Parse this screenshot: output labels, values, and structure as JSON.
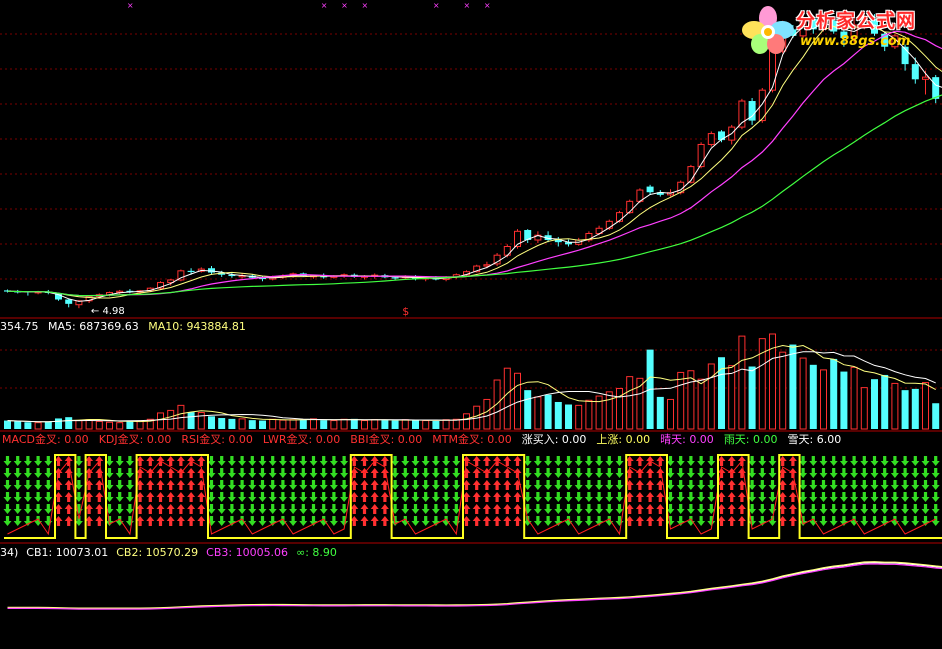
{
  "chart_data": [
    {
      "type": "candlestick",
      "annotations": {
        "low_label": "4.98",
        "top_markers": [
          "×",
          "×",
          "×",
          "×",
          "×",
          "×",
          "×"
        ],
        "signal_marker": "$"
      },
      "colors": {
        "up": "#ff3030",
        "down": "#54ffff",
        "ma_fast": "#ffffff",
        "ma_mid": "#ffff80",
        "ma_slow": "#ff40ff",
        "ma_long": "#40ff40"
      },
      "ohlc": [
        [
          5.39,
          5.41,
          5.34,
          5.37
        ],
        [
          5.37,
          5.4,
          5.32,
          5.36
        ],
        [
          5.37,
          5.36,
          5.27,
          5.35
        ],
        [
          5.35,
          5.38,
          5.3,
          5.36
        ],
        [
          5.36,
          5.4,
          5.3,
          5.33
        ],
        [
          5.33,
          5.34,
          5.15,
          5.18
        ],
        [
          5.18,
          5.2,
          5.0,
          5.08
        ],
        [
          5.06,
          5.17,
          4.98,
          5.15
        ],
        [
          5.15,
          5.27,
          5.1,
          5.25
        ],
        [
          5.25,
          5.32,
          5.2,
          5.29
        ],
        [
          5.29,
          5.36,
          5.25,
          5.34
        ],
        [
          5.34,
          5.4,
          5.3,
          5.37
        ],
        [
          5.38,
          5.42,
          5.32,
          5.35
        ],
        [
          5.35,
          5.4,
          5.3,
          5.38
        ],
        [
          5.38,
          5.46,
          5.35,
          5.44
        ],
        [
          5.44,
          5.6,
          5.4,
          5.57
        ],
        [
          5.57,
          5.65,
          5.5,
          5.63
        ],
        [
          5.63,
          5.87,
          5.6,
          5.84
        ],
        [
          5.84,
          5.9,
          5.75,
          5.83
        ],
        [
          5.83,
          5.92,
          5.8,
          5.88
        ],
        [
          5.9,
          5.95,
          5.75,
          5.8
        ],
        [
          5.8,
          5.84,
          5.7,
          5.75
        ],
        [
          5.75,
          5.8,
          5.68,
          5.72
        ],
        [
          5.72,
          5.78,
          5.66,
          5.73
        ],
        [
          5.73,
          5.76,
          5.65,
          5.68
        ],
        [
          5.7,
          5.72,
          5.6,
          5.65
        ],
        [
          5.65,
          5.73,
          5.62,
          5.7
        ],
        [
          5.7,
          5.76,
          5.65,
          5.72
        ],
        [
          5.72,
          5.8,
          5.68,
          5.77
        ],
        [
          5.78,
          5.8,
          5.7,
          5.72
        ],
        [
          5.72,
          5.75,
          5.66,
          5.73
        ],
        [
          5.74,
          5.78,
          5.66,
          5.69
        ],
        [
          5.69,
          5.74,
          5.66,
          5.72
        ],
        [
          5.72,
          5.78,
          5.68,
          5.75
        ],
        [
          5.75,
          5.78,
          5.68,
          5.7
        ],
        [
          5.7,
          5.74,
          5.64,
          5.72
        ],
        [
          5.72,
          5.78,
          5.66,
          5.74
        ],
        [
          5.74,
          5.77,
          5.67,
          5.69
        ],
        [
          5.69,
          5.72,
          5.62,
          5.68
        ],
        [
          5.68,
          5.74,
          5.64,
          5.71
        ],
        [
          5.7,
          5.74,
          5.62,
          5.66
        ],
        [
          5.66,
          5.7,
          5.6,
          5.68
        ],
        [
          5.69,
          5.72,
          5.62,
          5.64
        ],
        [
          5.64,
          5.72,
          5.6,
          5.7
        ],
        [
          5.7,
          5.78,
          5.66,
          5.75
        ],
        [
          5.75,
          5.85,
          5.72,
          5.82
        ],
        [
          5.82,
          5.98,
          5.8,
          5.95
        ],
        [
          5.95,
          6.05,
          5.9,
          5.98
        ],
        [
          6.0,
          6.25,
          5.95,
          6.2
        ],
        [
          6.2,
          6.45,
          6.15,
          6.4
        ],
        [
          6.4,
          6.8,
          6.35,
          6.75
        ],
        [
          6.78,
          6.8,
          6.48,
          6.55
        ],
        [
          6.55,
          6.75,
          6.48,
          6.66
        ],
        [
          6.66,
          6.75,
          6.5,
          6.55
        ],
        [
          6.55,
          6.62,
          6.4,
          6.5
        ],
        [
          6.5,
          6.56,
          6.4,
          6.45
        ],
        [
          6.45,
          6.6,
          6.42,
          6.55
        ],
        [
          6.55,
          6.75,
          6.5,
          6.7
        ],
        [
          6.7,
          6.88,
          6.66,
          6.82
        ],
        [
          6.82,
          7.02,
          6.78,
          6.98
        ],
        [
          6.98,
          7.22,
          6.95,
          7.18
        ],
        [
          7.18,
          7.48,
          7.15,
          7.44
        ],
        [
          7.44,
          7.74,
          7.4,
          7.7
        ],
        [
          7.78,
          7.82,
          7.6,
          7.65
        ],
        [
          7.65,
          7.7,
          7.55,
          7.59
        ],
        [
          7.59,
          7.72,
          7.55,
          7.64
        ],
        [
          7.64,
          7.92,
          7.6,
          7.88
        ],
        [
          7.88,
          8.28,
          7.85,
          8.24
        ],
        [
          8.24,
          8.8,
          8.2,
          8.75
        ],
        [
          8.75,
          9.05,
          8.7,
          9.0
        ],
        [
          9.05,
          9.08,
          8.8,
          8.85
        ],
        [
          8.85,
          9.2,
          8.75,
          9.15
        ],
        [
          9.15,
          9.8,
          9.1,
          9.75
        ],
        [
          9.75,
          9.82,
          9.2,
          9.3
        ],
        [
          9.3,
          10.05,
          9.25,
          10.0
        ],
        [
          10.0,
          11.0,
          9.95,
          10.9
        ],
        [
          10.9,
          11.6,
          10.85,
          11.55
        ],
        [
          11.4,
          11.5,
          11.2,
          11.25
        ],
        [
          11.25,
          11.75,
          11.2,
          11.6
        ],
        [
          11.65,
          11.7,
          11.3,
          11.4
        ],
        [
          11.4,
          11.72,
          11.35,
          11.65
        ],
        [
          11.6,
          11.7,
          11.3,
          11.35
        ],
        [
          11.35,
          11.4,
          11.0,
          11.2
        ],
        [
          11.2,
          11.75,
          11.1,
          11.5
        ],
        [
          11.5,
          11.78,
          11.4,
          11.7
        ],
        [
          11.65,
          11.75,
          11.25,
          11.3
        ],
        [
          11.3,
          11.35,
          10.9,
          11.0
        ],
        [
          11.0,
          11.3,
          10.95,
          11.25
        ],
        [
          11.0,
          11.05,
          10.45,
          10.6
        ],
        [
          10.6,
          10.75,
          10.15,
          10.25
        ],
        [
          10.25,
          10.45,
          9.9,
          10.3
        ],
        [
          10.3,
          10.35,
          9.7,
          9.8
        ],
        [
          9.82,
          10.1,
          9.75,
          10.0
        ]
      ]
    },
    {
      "type": "bar",
      "legend": {
        "vol": "354.75",
        "ma5_label": "MA5: ",
        "ma5": "687369.63",
        "ma10_label": "MA10: ",
        "ma10": "943884.81"
      },
      "colors": {
        "label": "#ffffff",
        "ma5": "#ffff80",
        "ma10": "#ffffff"
      },
      "values": [
        2.0,
        1.8,
        1.6,
        1.5,
        1.7,
        2.5,
        2.8,
        2.0,
        2.2,
        1.8,
        1.6,
        1.5,
        2.0,
        1.9,
        2.3,
        3.8,
        4.4,
        5.6,
        4.0,
        3.9,
        3.0,
        2.6,
        2.4,
        2.4,
        2.1,
        2.0,
        2.3,
        2.1,
        2.2,
        2.3,
        2.4,
        2.1,
        2.0,
        2.3,
        2.4,
        2.0,
        2.2,
        2.1,
        2.0,
        2.2,
        2.1,
        2.0,
        1.9,
        2.2,
        2.3,
        3.6,
        5.4,
        7.0,
        11.6,
        14.4,
        13.2,
        9.2,
        7.6,
        8.1,
        6.4,
        5.8,
        5.6,
        6.8,
        7.8,
        8.8,
        9.6,
        12.4,
        12.0,
        18.8,
        7.6,
        7.0,
        13.4,
        13.8,
        11.8,
        15.4,
        17.0,
        15.0,
        22.0,
        14.8,
        21.4,
        22.5,
        18.2,
        20.0,
        16.8,
        15.2,
        14.0,
        16.6,
        13.6,
        14.6,
        9.8,
        11.8,
        12.8,
        10.8,
        9.2,
        9.5,
        11.0,
        6.1
      ]
    },
    {
      "type": "table",
      "legend": [
        {
          "label": "MACD金叉: ",
          "value": "0.00",
          "color": "#ff3030"
        },
        {
          "label": "KDJ金叉: ",
          "value": "0.00",
          "color": "#ff3030"
        },
        {
          "label": "RSI金叉: ",
          "value": "0.00",
          "color": "#ff3030"
        },
        {
          "label": "LWR金叉: ",
          "value": "0.00",
          "color": "#ff3030"
        },
        {
          "label": "BBI金叉: ",
          "value": "0.00",
          "color": "#ff3030"
        },
        {
          "label": "MTM金叉: ",
          "value": "0.00",
          "color": "#ff3030"
        },
        {
          "label": "涨买入: ",
          "value": "0.00",
          "color": "#ffffff"
        },
        {
          "label": "上涨: ",
          "value": "0.00",
          "color": "#ffff60"
        },
        {
          "label": "晴天: ",
          "value": "0.00",
          "color": "#ff40ff"
        },
        {
          "label": "雨天: ",
          "value": "0.00",
          "color": "#40ff40"
        },
        {
          "label": "雪天: ",
          "value": "6.00",
          "color": "#ffffff"
        }
      ],
      "state": [
        0,
        0,
        0,
        0,
        0,
        1,
        1,
        0,
        1,
        1,
        0,
        0,
        0,
        1,
        1,
        1,
        1,
        1,
        1,
        1,
        0,
        0,
        0,
        0,
        0,
        0,
        0,
        0,
        0,
        0,
        0,
        0,
        0,
        0,
        1,
        1,
        1,
        1,
        0,
        0,
        0,
        0,
        0,
        0,
        0,
        1,
        1,
        1,
        1,
        1,
        1,
        0,
        0,
        0,
        0,
        0,
        0,
        0,
        0,
        0,
        0,
        1,
        1,
        1,
        1,
        0,
        0,
        0,
        0,
        0,
        1,
        1,
        1,
        0,
        0,
        0,
        1,
        1,
        0,
        0,
        0,
        0,
        0,
        0,
        0,
        0,
        0,
        0,
        0,
        0,
        0,
        0
      ]
    },
    {
      "type": "line",
      "legend": [
        {
          "text": "34)",
          "color": "#ffffff"
        },
        {
          "text": "CB1: 10073.01",
          "color": "#ffffff"
        },
        {
          "text": "CB2: 10570.29",
          "color": "#ffff80"
        },
        {
          "text": "CB3: 10005.06",
          "color": "#ff40ff"
        },
        {
          "text": "∞: 8.90",
          "color": "#40ff40"
        }
      ]
    }
  ],
  "logo": {
    "title": "分析家公式网",
    "url": "www.88gs.com"
  }
}
